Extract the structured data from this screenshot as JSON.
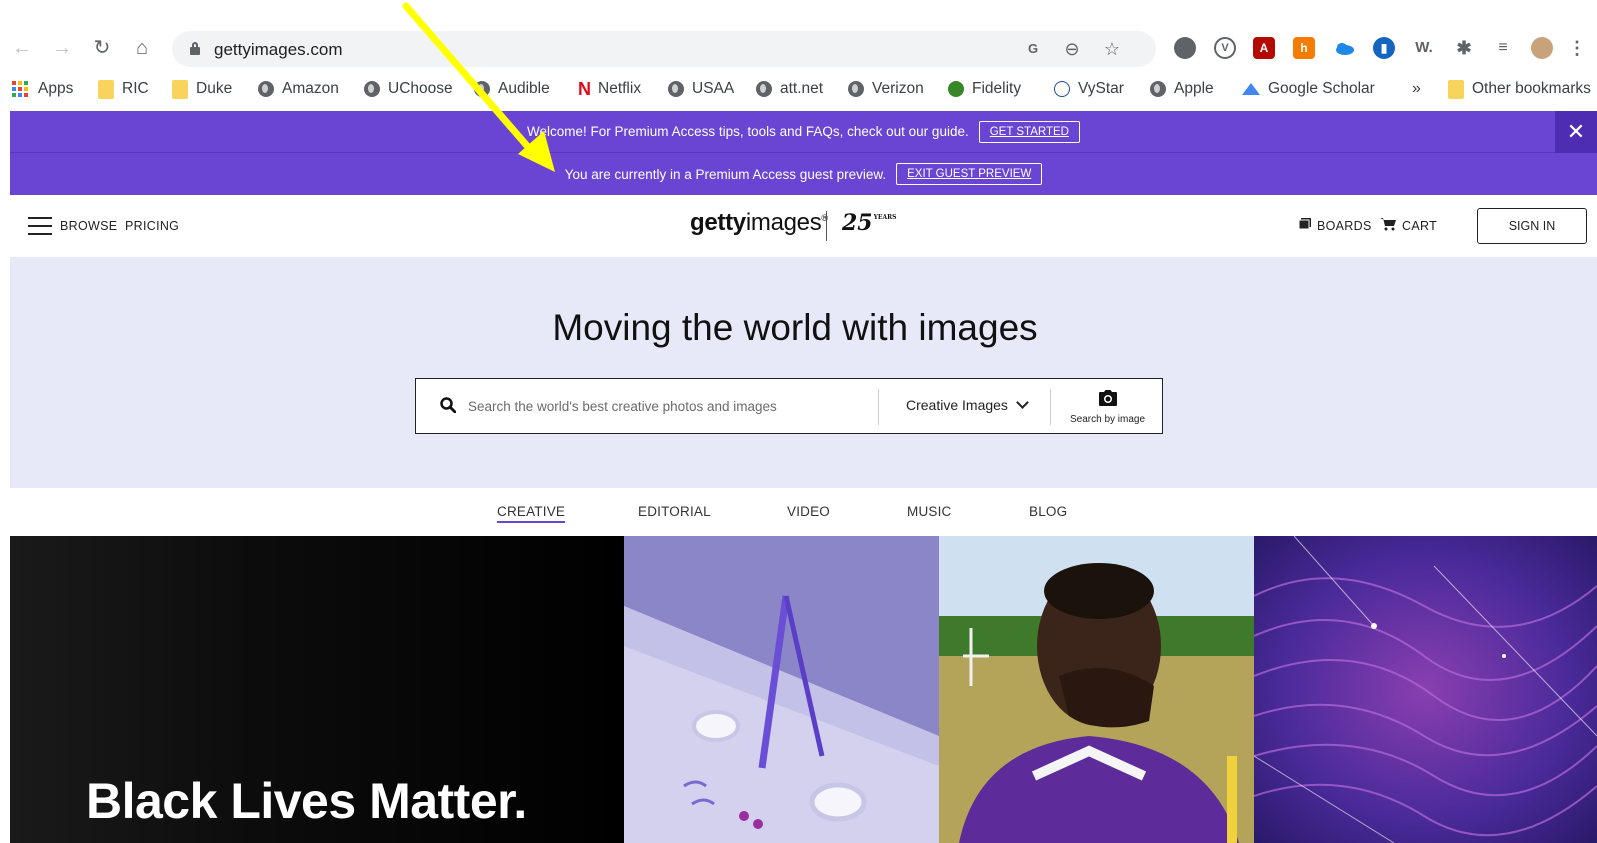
{
  "browser": {
    "url": "gettyimages.com",
    "bookmarks": [
      "Apps",
      "RIC",
      "Duke",
      "Amazon",
      "UChoose",
      "Audible",
      "Netflix",
      "USAA",
      "att.net",
      "Verizon",
      "Fidelity",
      "VyStar",
      "Apple",
      "Google Scholar"
    ],
    "overflow": "»",
    "other_bookmarks": "Other bookmarks",
    "extension_labels": {
      "wikipedia": "W."
    }
  },
  "banner": {
    "welcome_text": "Welcome! For Premium Access tips, tools and FAQs, check out our guide.",
    "get_started": "GET STARTED",
    "preview_text": "You are currently in a Premium Access guest preview.",
    "exit_preview": "EXIT GUEST PREVIEW",
    "close": "✕",
    "color": "#6a45d4"
  },
  "header": {
    "browse": "BROWSE",
    "pricing": "PRICING",
    "logo_bold": "getty",
    "logo_light": "images",
    "logo_mark": "®",
    "anniversary": "25",
    "anniversary_sub": "YEARS",
    "boards": "BOARDS",
    "cart": "CART",
    "sign_in": "SIGN IN"
  },
  "hero": {
    "title": "Moving the world with images",
    "search_placeholder": "Search the world's best creative photos and images",
    "search_type": "Creative Images",
    "search_by_image": "Search by image"
  },
  "categories": [
    {
      "label": "CREATIVE",
      "active": true
    },
    {
      "label": "EDITORIAL",
      "active": false
    },
    {
      "label": "VIDEO",
      "active": false
    },
    {
      "label": "MUSIC",
      "active": false
    },
    {
      "label": "BLOG",
      "active": false
    }
  ],
  "tiles": {
    "feature_text": "Black Lives Matter."
  },
  "annotation": {
    "arrow_color": "#ffff00"
  }
}
